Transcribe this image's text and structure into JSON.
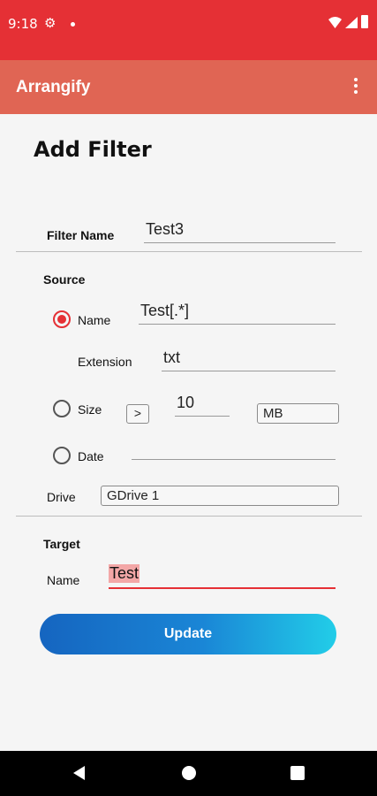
{
  "status_bar": {
    "time": "9:18"
  },
  "app_bar": {
    "title": "Arrangify"
  },
  "page": {
    "title": "Add Filter"
  },
  "filter_name": {
    "label": "Filter Name",
    "value": "Test3"
  },
  "source": {
    "heading": "Source",
    "name": {
      "label": "Name",
      "value": "Test[.*]",
      "selected": true
    },
    "extension": {
      "label": "Extension",
      "value": "txt"
    },
    "size": {
      "label": "Size",
      "operator": ">",
      "value": "10",
      "unit": "MB",
      "selected": false
    },
    "date": {
      "label": "Date",
      "value": "",
      "selected": false
    },
    "drive": {
      "label": "Drive",
      "value": "GDrive 1"
    }
  },
  "target": {
    "heading": "Target",
    "name_label": "Name",
    "name_value": "Test"
  },
  "update_button": {
    "label": "Update"
  },
  "colors": {
    "status_bar": "#e53035",
    "app_bar": "#e06554",
    "accent": "#e53035",
    "button_start": "#1565c0",
    "button_end": "#22cde8"
  }
}
